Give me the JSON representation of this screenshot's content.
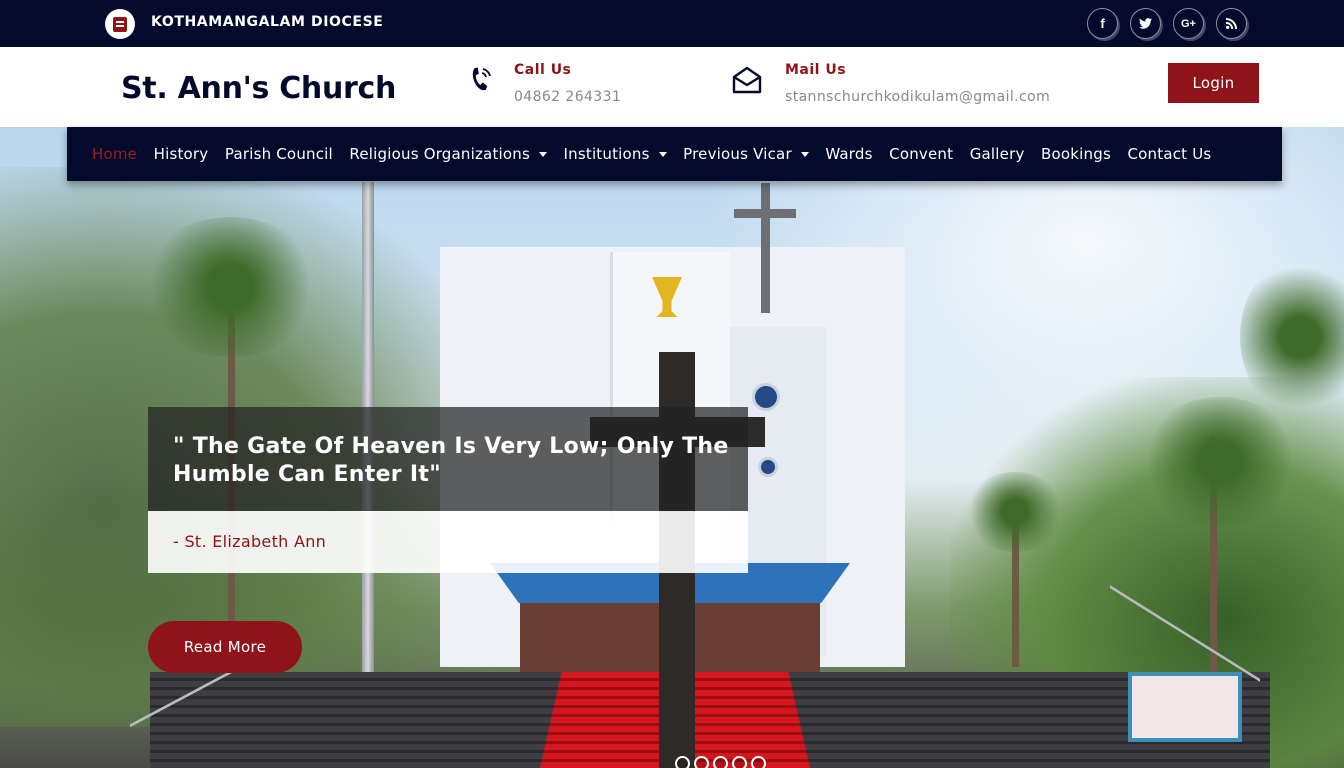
{
  "topbar": {
    "diocese": "KOTHAMANGALAM DIOCESE",
    "logo_icon": "book-icon",
    "social": [
      {
        "name": "facebook-icon",
        "glyph": "f"
      },
      {
        "name": "twitter-icon",
        "glyph": "t"
      },
      {
        "name": "google-plus-icon",
        "glyph": "G+"
      },
      {
        "name": "rss-icon",
        "glyph": "≈"
      }
    ]
  },
  "header": {
    "title": "St. Ann's Church",
    "call_label": "Call Us",
    "call_value": "04862 264331",
    "call_icon": "phone-icon",
    "mail_label": "Mail Us",
    "mail_value": "stannschurchkodikulam@gmail.com",
    "mail_icon": "envelope-open-icon",
    "login_label": "Login"
  },
  "nav": {
    "items": [
      {
        "label": "Home",
        "active": true,
        "dropdown": false
      },
      {
        "label": "History",
        "dropdown": false
      },
      {
        "label": "Parish Council",
        "dropdown": false
      },
      {
        "label": "Religious Organizations",
        "dropdown": true
      },
      {
        "label": "Institutions",
        "dropdown": true
      },
      {
        "label": "Previous Vicar",
        "dropdown": true
      },
      {
        "label": "Wards",
        "dropdown": false
      },
      {
        "label": "Convent",
        "dropdown": false
      },
      {
        "label": "Gallery",
        "dropdown": false
      },
      {
        "label": "Bookings",
        "dropdown": false
      },
      {
        "label": "Contact Us",
        "dropdown": false
      }
    ]
  },
  "hero": {
    "quote": "\" The Gate Of Heaven Is Very Low; Only The Humble Can Enter It\"",
    "author": "- St. Elizabeth Ann",
    "read_more": "Read More",
    "slide_count": 5
  },
  "colors": {
    "navy": "#040a2c",
    "maroon": "#8e1419",
    "muted_text": "#888888"
  }
}
